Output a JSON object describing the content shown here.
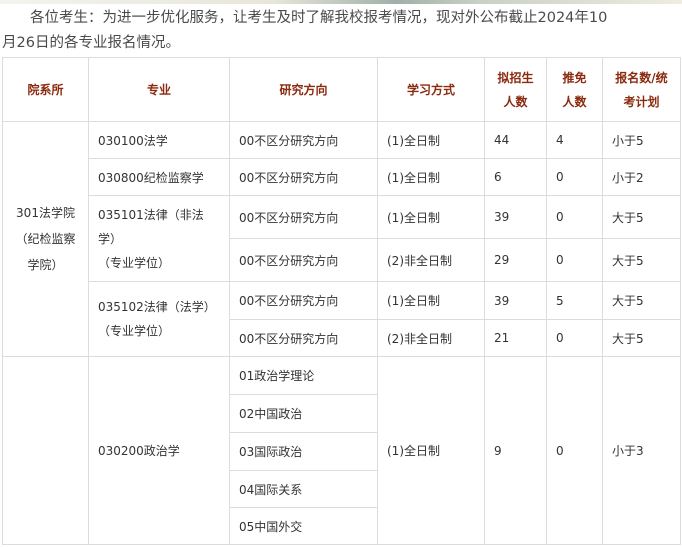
{
  "intro": {
    "line1": "各位考生：为进一步优化服务，让考生及时了解我校报考情况，现对外公布截止2024年10",
    "line2": "月26日的各专业报名情况。"
  },
  "table": {
    "headers": {
      "dept": "院系所",
      "major": "专业",
      "direction": "研究方向",
      "mode": "学习方式",
      "plan_line1": "拟招生",
      "plan_line2": "人数",
      "exempt_line1": "推免",
      "exempt_line2": "人数",
      "ratio_line1": "报名数/统",
      "ratio_line2": "考计划"
    },
    "dept_301": {
      "line1": "301法学院",
      "line2": "（纪检监察",
      "line3": "学院）"
    },
    "rows": [
      {
        "major": "030100法学",
        "direction": "00不区分研究方向",
        "mode": "(1)全日制",
        "plan": "44",
        "exempt": "4",
        "ratio": "小于5"
      },
      {
        "major": "030800纪检监察学",
        "direction": "00不区分研究方向",
        "mode": "(1)全日制",
        "plan": "6",
        "exempt": "0",
        "ratio": "小于2"
      },
      {
        "major_line1": "035101法律（非法",
        "major_line2": "学）",
        "major_line3": "（专业学位）",
        "direction": "00不区分研究方向",
        "mode": "(1)全日制",
        "plan": "39",
        "exempt": "0",
        "ratio": "大于5"
      },
      {
        "direction": "00不区分研究方向",
        "mode": "(2)非全日制",
        "plan": "29",
        "exempt": "0",
        "ratio": "大于5"
      },
      {
        "major_line1": "035102法律（法学）",
        "major_line2": "（专业学位）",
        "direction": "00不区分研究方向",
        "mode": "(1)全日制",
        "plan": "39",
        "exempt": "5",
        "ratio": "大于5"
      },
      {
        "direction": "00不区分研究方向",
        "mode": "(2)非全日制",
        "plan": "21",
        "exempt": "0",
        "ratio": "大于5"
      }
    ],
    "politics": {
      "major": "030200政治学",
      "directions": [
        "01政治学理论",
        "02中国政治",
        "03国际政治",
        "04国际关系",
        "05中国外交"
      ],
      "mode": "(1)全日制",
      "plan": "9",
      "exempt": "0",
      "ratio": "小于3"
    }
  }
}
